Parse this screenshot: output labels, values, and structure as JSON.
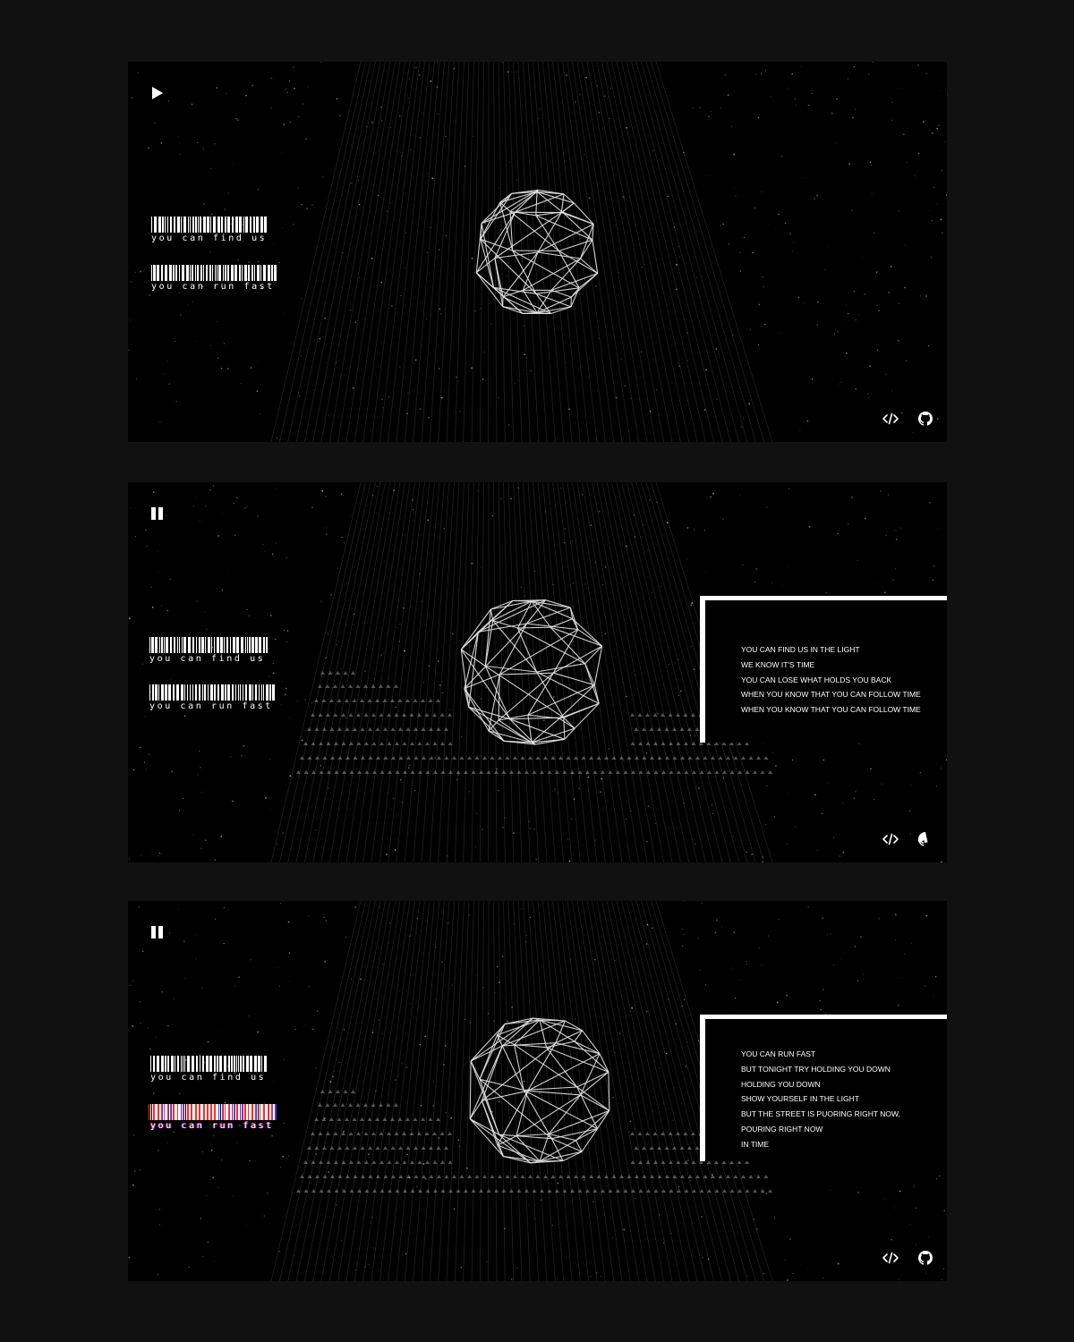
{
  "colors": {
    "page_background": "#111111",
    "panel_background": "#000000",
    "foreground": "#ffffff",
    "grid_lines": "#3a3a3a",
    "glitch_red": "#ff2a2a",
    "glitch_blue": "#2d3cff"
  },
  "panels": [
    {
      "player_control": "play-icon",
      "tracks": [
        {
          "label": "you can find us",
          "glitch": false
        },
        {
          "label": "you can run fast",
          "glitch": false
        }
      ],
      "lyrics": null,
      "footer_icons": [
        "code-icon",
        "github-icon"
      ]
    },
    {
      "player_control": "pause-icon",
      "tracks": [
        {
          "label": "you can find us",
          "glitch": false
        },
        {
          "label": "you can run fast",
          "glitch": false
        }
      ],
      "lyrics": [
        "YOU CAN FIND US IN THE LIGHT",
        "WE KNOW IT'S TIME",
        "YOU CAN LOSE WHAT HOLDS YOU BACK",
        "WHEN YOU KNOW THAT YOU CAN FOLLOW TIME",
        "WHEN YOU KNOW THAT YOU CAN FOLLOW TIME"
      ],
      "footer_icons": [
        "code-icon",
        "github-icon"
      ]
    },
    {
      "player_control": "pause-icon",
      "tracks": [
        {
          "label": "you can find us",
          "glitch": false
        },
        {
          "label": "you can run fast",
          "glitch": true
        }
      ],
      "lyrics": [
        "YOU CAN RUN FAST",
        "BUT TONIGHT TRY HOLDING YOU DOWN",
        "HOLDING YOU DOWN",
        "SHOW YOURSELF IN THE LIGHT",
        "BUT THE STREET IS PUORING RIGHT NOW,",
        "POURING RIGHT NOW",
        "IN TIME"
      ],
      "footer_icons": [
        "code-icon",
        "github-icon"
      ]
    }
  ]
}
